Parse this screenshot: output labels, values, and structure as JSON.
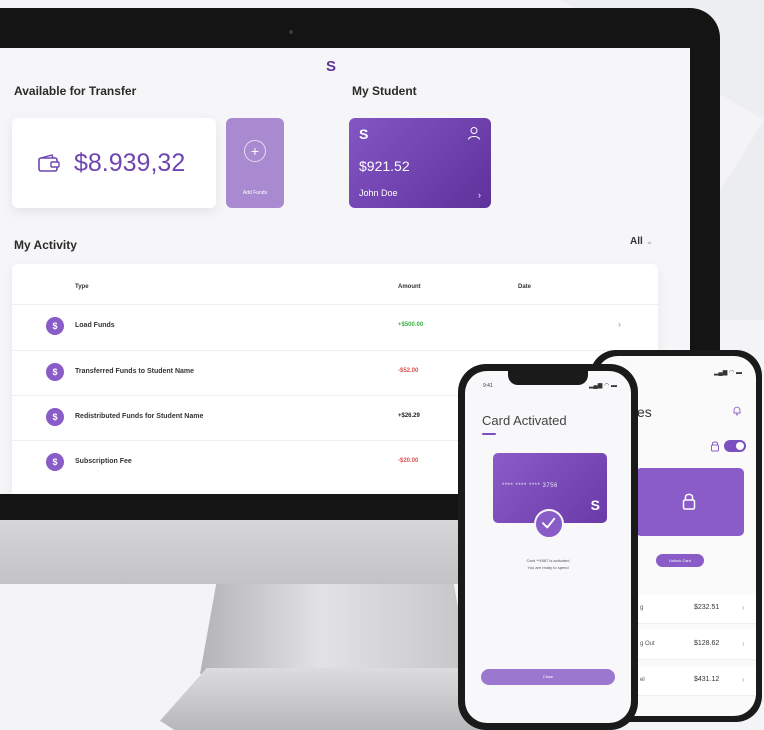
{
  "app": {
    "logo": "S"
  },
  "transfer": {
    "title": "Available for Transfer",
    "balance": "$8.939,32",
    "add_funds_label": "Add Funds",
    "add_icon": "plus-icon",
    "wallet_icon": "wallet-icon"
  },
  "student": {
    "title": "My Student",
    "logo": "S",
    "amount": "$921.52",
    "name": "John Doe",
    "chevron": "›",
    "user_icon": "user-icon"
  },
  "activity": {
    "title": "My Activity",
    "filter_label": "All",
    "filter_chevron": "⌄",
    "headers": {
      "type": "Type",
      "amount": "Amount",
      "date": "Date"
    },
    "rows": [
      {
        "icon": "$",
        "type": "Load Funds",
        "amount": "+$500.00",
        "amount_color": "#3cb043",
        "date": "",
        "chevron": "›"
      },
      {
        "icon": "$",
        "type": "Transferred Funds to Student Name",
        "amount": "-$52.00",
        "amount_color": "#d9534f",
        "date": "",
        "chevron": ""
      },
      {
        "icon": "$",
        "type": "Redistributed Funds for Student Name",
        "amount": "+$26.29",
        "amount_color": "#222222",
        "date": "",
        "chevron": ""
      },
      {
        "icon": "$",
        "type": "Subscription Fee",
        "amount": "-$20.00",
        "amount_color": "#d9534f",
        "date": "",
        "chevron": ""
      }
    ]
  },
  "phone_front": {
    "time": "9:41",
    "status": "▂▄▆ ◠ ▬",
    "title": "Card Activated",
    "card_number": "**** **** **** 3756",
    "card_logo": "S",
    "message_line1": "Card **4587 is activated",
    "message_line2": "You are ready to spend",
    "button_label": "Close"
  },
  "phone_back": {
    "status": "▂▄▆ ◠ ▬",
    "title_partial": "ces",
    "button_label": "Unlock Card",
    "rows": [
      {
        "label": "g",
        "amount": "$232.51",
        "chevron": "›"
      },
      {
        "label": "g Out",
        "amount": "$128.62",
        "chevron": "›"
      },
      {
        "label": "el",
        "amount": "$431.12",
        "chevron": "›"
      }
    ]
  },
  "colors": {
    "brand": "#7b4fc0",
    "brand_light": "#a98ad0",
    "positive": "#3cb043",
    "negative": "#d9534f"
  }
}
